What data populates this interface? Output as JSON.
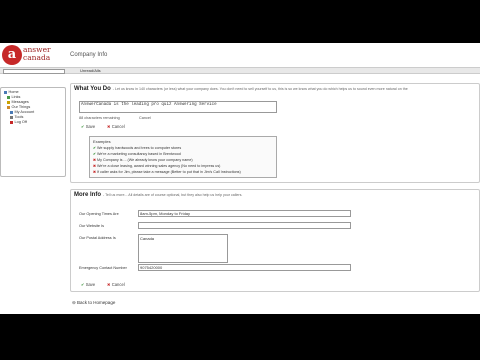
{
  "header": {
    "logo_letter": "a",
    "logo_line1": "answer",
    "logo_line2": "canada",
    "page_title": "Company Info"
  },
  "toolbar": {
    "link_label": "Unread/Alls"
  },
  "sidebar": {
    "items": [
      {
        "label": "Home",
        "icon": "home-icon",
        "color": "#4a7ab5"
      },
      {
        "label": "Links",
        "icon": "link-icon",
        "color": "#4a9a4a"
      },
      {
        "label": "Messages",
        "icon": "envelope-icon",
        "color": "#c9a200"
      },
      {
        "label": "Our Things",
        "icon": "folder-icon",
        "color": "#d08a2a"
      },
      {
        "label": "My Account",
        "icon": "user-icon",
        "color": "#4a7ab5"
      },
      {
        "label": "Tools",
        "icon": "wrench-icon",
        "color": "#777777"
      },
      {
        "label": "Log Off",
        "icon": "logoff-icon",
        "color": "#c62828"
      }
    ]
  },
  "what_you_do": {
    "title": "What You Do",
    "note": "- Let us know in 140 characters (or less) what your company does. You don't need to sell yourself to us, this is so we know what you do which helps us to sound even more natural on the",
    "value": "AnswerCanada is the leading pro quiz Answering Service",
    "chars_remaining": "88 characters remaining",
    "cancel_hint": "Cancel",
    "save_label": "Save",
    "cancel_label": "Cancel",
    "examples_title": "Examples",
    "examples": [
      {
        "ok": true,
        "text": "We supply hardwoods and trees to computer stores"
      },
      {
        "ok": true,
        "text": "We're a marketing consultancy based in Brentwood"
      },
      {
        "ok": false,
        "text": "My Company is ... (We already know your company name)"
      },
      {
        "ok": false,
        "text": "We're a close leasing, award winning sales agency (No need to impress us)"
      },
      {
        "ok": false,
        "text": "If caller asks for Jim, please take a message (Better to put that in Jim's Call Instructions)"
      }
    ]
  },
  "more_info": {
    "title": "More Info",
    "note": "- Tell us more... All details are of course optional, but they also help us help your callers.",
    "fields": {
      "hours_label": "Our Opening Times Are",
      "hours_value": "8am-5pm, Monday to Friday",
      "website_label": "Our Website Is",
      "website_value": "",
      "postal_label": "Our Postal Address Is",
      "postal_value": "Canada",
      "emergency_label": "Emergency Contact Number",
      "emergency_value": "9075420000"
    },
    "save_label": "Save",
    "cancel_label": "Cancel"
  },
  "footer": {
    "back_label": "Back to Homepage"
  },
  "colors": {
    "brand_red": "#c62828",
    "ok_green": "#2e8b2e"
  }
}
